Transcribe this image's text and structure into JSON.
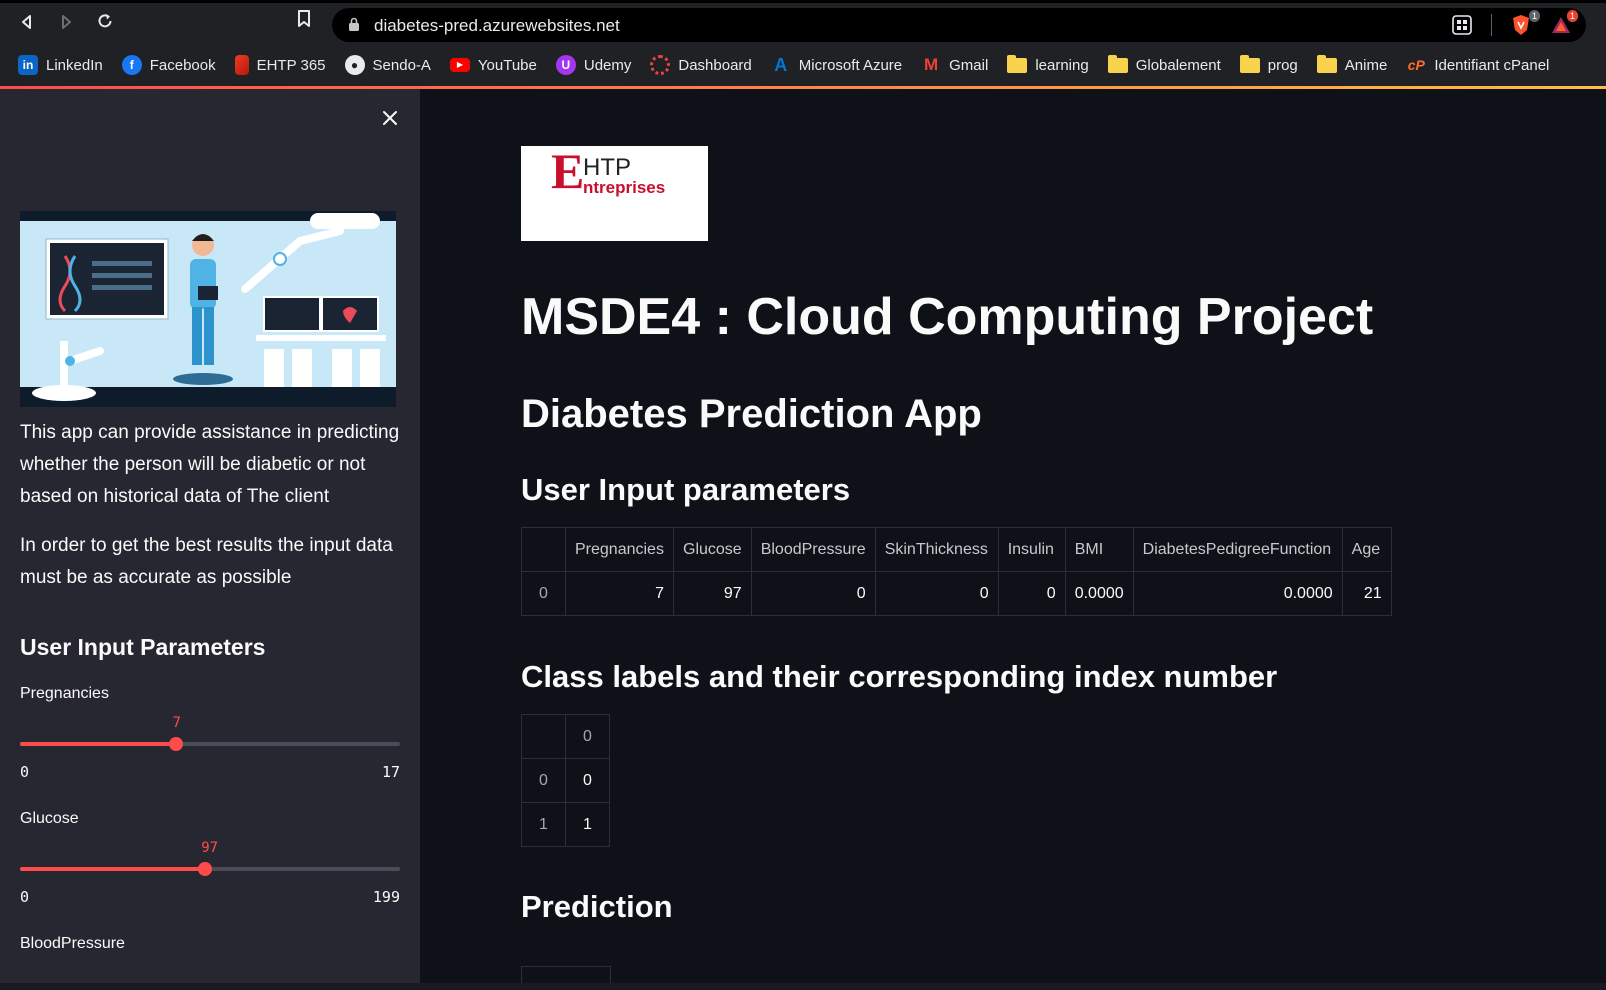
{
  "browser": {
    "url": "diabetes-pred.azurewebsites.net",
    "bookmarks": [
      {
        "label": "LinkedIn",
        "icon": "linkedin-icon",
        "color": "#0a66c2"
      },
      {
        "label": "Facebook",
        "icon": "facebook-icon",
        "color": "#1877f2"
      },
      {
        "label": "EHTP 365",
        "icon": "office-icon",
        "color": "#d83b01"
      },
      {
        "label": "Sendo-A",
        "icon": "github-icon",
        "color": "#e8eaed"
      },
      {
        "label": "YouTube",
        "icon": "youtube-icon",
        "color": "#ff0000"
      },
      {
        "label": "Udemy",
        "icon": "udemy-icon",
        "color": "#a435f0"
      },
      {
        "label": "Dashboard",
        "icon": "dashboard-icon",
        "color": "#e8453c"
      },
      {
        "label": "Microsoft Azure",
        "icon": "azure-icon",
        "color": "#0078d4"
      },
      {
        "label": "Gmail",
        "icon": "gmail-icon",
        "color": "#ea4335"
      },
      {
        "label": "learning",
        "icon": "folder-icon",
        "color": "#f8d34e"
      },
      {
        "label": "Globalement",
        "icon": "folder-icon",
        "color": "#f8d34e"
      },
      {
        "label": "prog",
        "icon": "folder-icon",
        "color": "#f8d34e"
      },
      {
        "label": "Anime",
        "icon": "folder-icon",
        "color": "#f8d34e"
      },
      {
        "label": "Identifiant cPanel",
        "icon": "cpanel-icon",
        "color": "#ff6c2c"
      }
    ],
    "brave_badge": "1",
    "rewards_badge": "1"
  },
  "sidebar": {
    "description": "This app can provide assistance in predicting whether the person will be diabetic or not based on historical data of The client",
    "advice": "In order to get the best results the input data must be as accurate as possible",
    "heading": "User Input Parameters",
    "sliders": [
      {
        "label": "Pregnancies",
        "value": 7,
        "min": 0,
        "max": 17
      },
      {
        "label": "Glucose",
        "value": 97,
        "min": 0,
        "max": 199
      }
    ],
    "next_label": "BloodPressure"
  },
  "main": {
    "logo": {
      "letter": "E",
      "line1": "HTP",
      "line2": "ntreprises"
    },
    "title": "MSDE4 : Cloud Computing Project",
    "subtitle": "Diabetes Prediction App",
    "input_heading": "User Input parameters",
    "input_table": {
      "columns": [
        "",
        "Pregnancies",
        "Glucose",
        "BloodPressure",
        "SkinThickness",
        "Insulin",
        "BMI",
        "DiabetesPedigreeFunction",
        "Age"
      ],
      "rows": [
        [
          "0",
          "7",
          "97",
          "0",
          "0",
          "0",
          "0.0000",
          "0.0000",
          "21"
        ]
      ]
    },
    "class_heading": "Class labels and their corresponding index number",
    "class_table": {
      "columns": [
        "",
        "0"
      ],
      "rows": [
        [
          "0",
          "0"
        ],
        [
          "1",
          "1"
        ]
      ]
    },
    "prediction_heading": "Prediction"
  },
  "colors": {
    "accent": "#ff4b4b",
    "sidebar_bg": "#262730",
    "main_bg": "#0e1117"
  }
}
